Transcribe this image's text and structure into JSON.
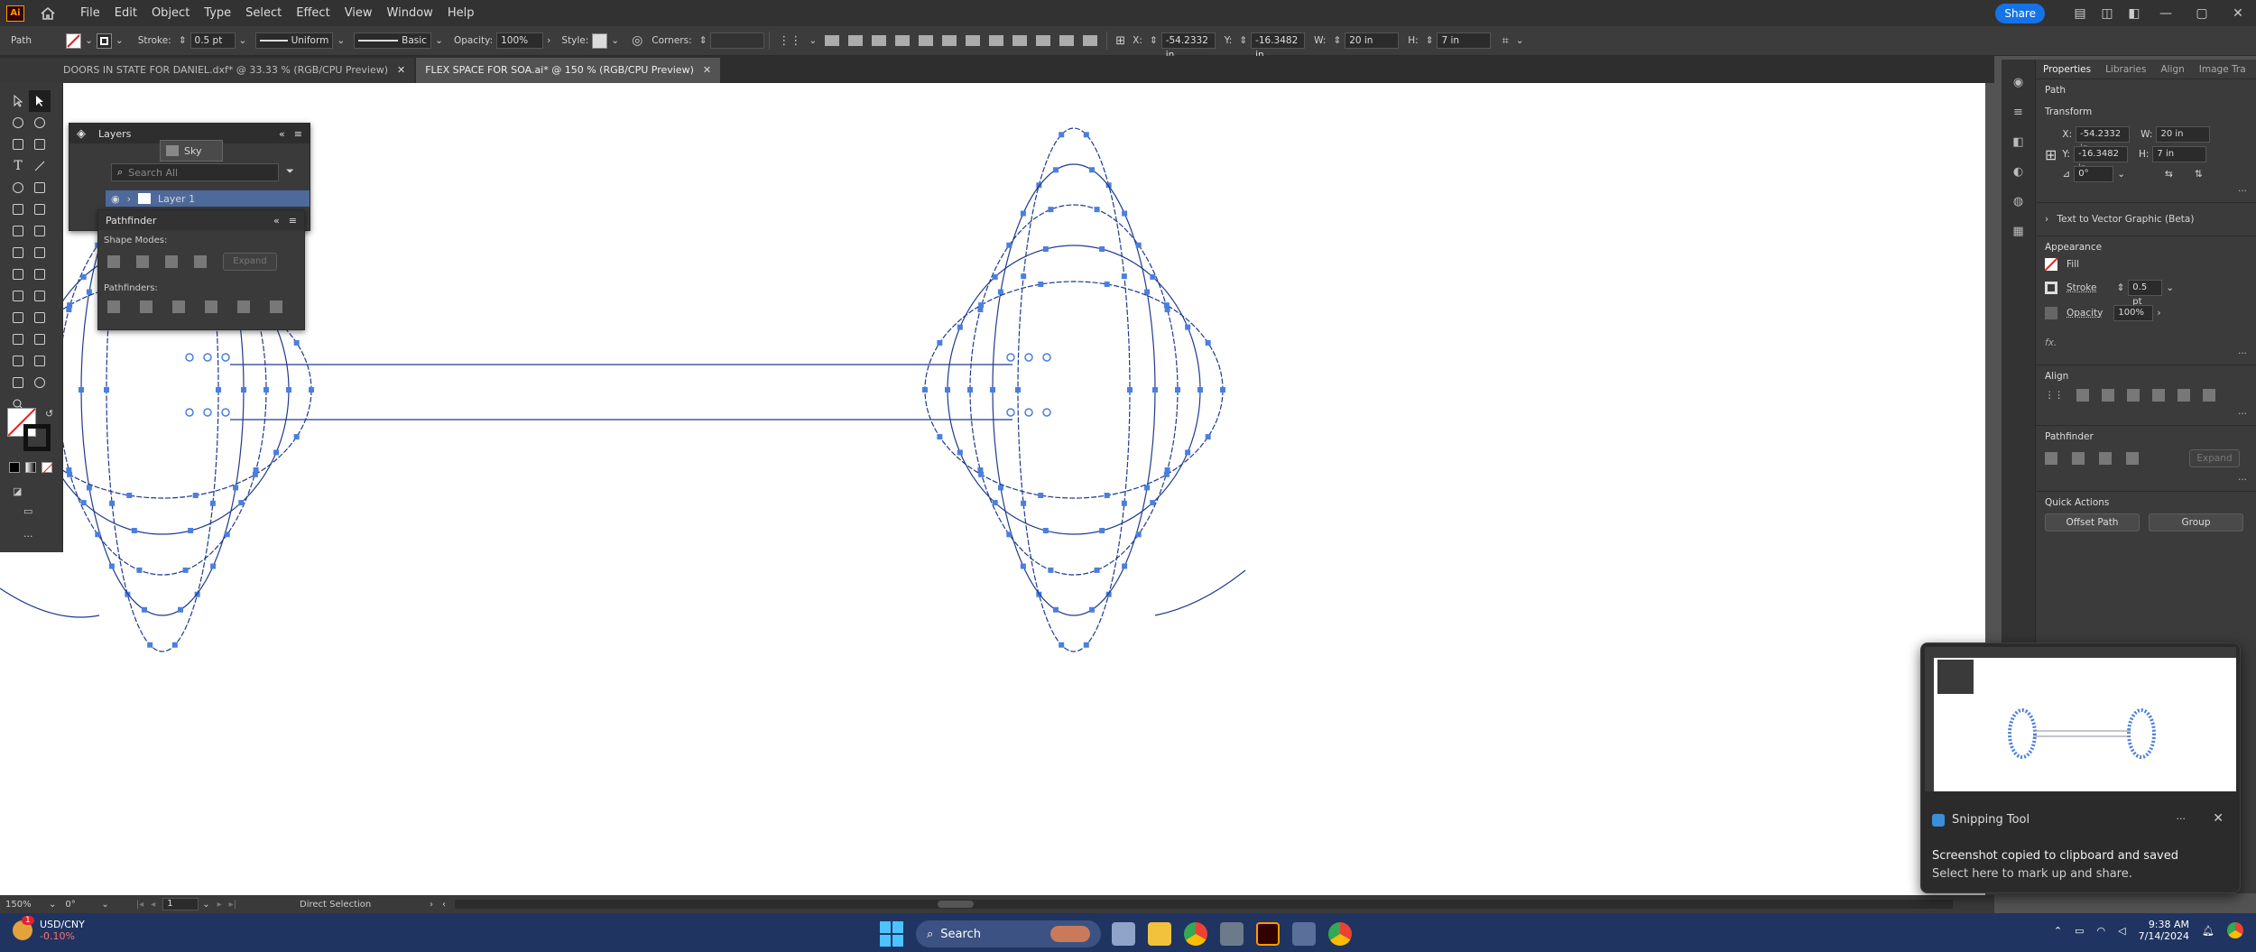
{
  "menubar": {
    "app_logo": "Ai",
    "menus": [
      "File",
      "Edit",
      "Object",
      "Type",
      "Select",
      "Effect",
      "View",
      "Window",
      "Help"
    ],
    "share_label": "Share"
  },
  "control_bar": {
    "selection_type": "Path",
    "stroke_label": "Stroke:",
    "stroke_value": "0.5 pt",
    "profile_value": "Uniform",
    "brush_value": "Basic",
    "opacity_label": "Opacity:",
    "opacity_value": "100%",
    "style_label": "Style:",
    "corners_label": "Corners:",
    "x_label": "X:",
    "x_value": "-54.2332 in",
    "y_label": "Y:",
    "y_value": "-16.3482 in",
    "w_label": "W:",
    "w_value": "20 in",
    "h_label": "H:",
    "h_value": "7 in"
  },
  "tabs": [
    {
      "label": "DOORS  IN STATE FOR DANIEL.dxf* @ 33.33 % (RGB/CPU Preview)",
      "active": false
    },
    {
      "label": "FLEX SPACE FOR SOA.ai* @ 150 % (RGB/CPU Preview)",
      "active": true
    }
  ],
  "layers_panel": {
    "title": "Layers",
    "search_placeholder": "Search All",
    "layer_name": "Layer 1",
    "sky_label": "Sky"
  },
  "pathfinder_panel": {
    "title": "Pathfinder",
    "shape_modes_label": "Shape Modes:",
    "expand_label": "Expand",
    "pathfinders_label": "Pathfinders:"
  },
  "right_panel": {
    "tabs": [
      "Properties",
      "Libraries",
      "Align",
      "Image Tra"
    ],
    "object_type": "Path",
    "transform_title": "Transform",
    "x_label": "X:",
    "x_value": "-54.2332 in",
    "w_label": "W:",
    "w_value": "20 in",
    "y_label": "Y:",
    "y_value": "-16.3482 in",
    "h_label": "H:",
    "h_value": "7 in",
    "angle_value": "0°",
    "text_to_vector": "Text to Vector Graphic (Beta)",
    "appearance_title": "Appearance",
    "fill_label": "Fill",
    "stroke_label": "Stroke",
    "stroke_value": "0.5 pt",
    "opacity_label": "Opacity",
    "opacity_value": "100%",
    "fx_label": "fx.",
    "align_title": "Align",
    "pathfinder_title": "Pathfinder",
    "expand_label": "Expand",
    "quick_actions_title": "Quick Actions",
    "offset_path_label": "Offset Path",
    "group_label": "Group"
  },
  "status_bar": {
    "zoom": "150%",
    "rotation": "0°",
    "artboard": "1",
    "tool": "Direct Selection"
  },
  "notification": {
    "app": "Snipping Tool",
    "line1": "Screenshot copied to clipboard and saved",
    "line2": "Select here to mark up and share."
  },
  "taskbar": {
    "currency": "USD/CNY",
    "change": "-0.10%",
    "badge": "1",
    "search_label": "Search",
    "time": "9:38 AM",
    "date": "7/14/2024"
  },
  "colors": {
    "accent": "#1473e6",
    "path_anchor": "#4a7fe0",
    "path_stroke": "#1f3b8c",
    "taskbar": "#1f3461"
  }
}
